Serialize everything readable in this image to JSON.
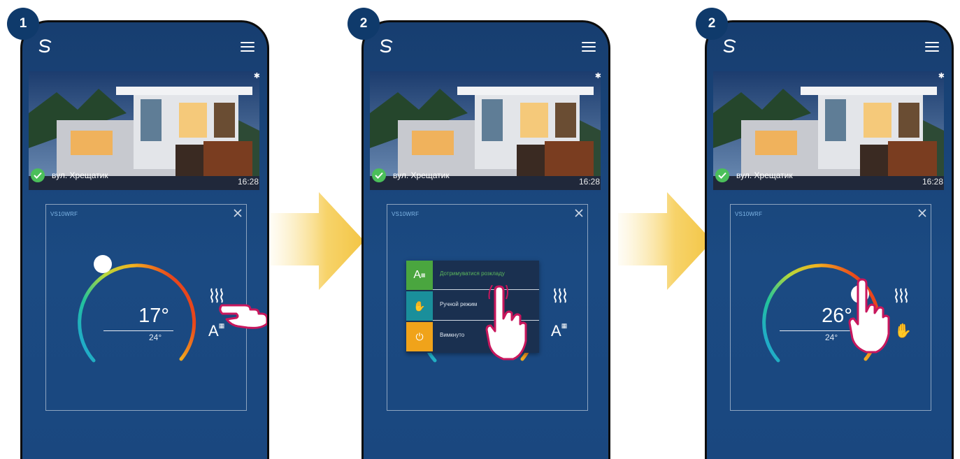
{
  "steps": [
    {
      "badge": "1",
      "location": "вул. Хрещатик",
      "time": "16:28",
      "device": "VS10WRF",
      "current_temp": "17°",
      "set_temp": "24°",
      "mode": "schedule"
    },
    {
      "badge": "2",
      "location": "вул. Хрещатик",
      "time": "16:28",
      "device": "VS10WRF",
      "mode_menu": [
        {
          "label": "Дотримуватися розкладу",
          "icon": "auto-schedule-icon",
          "color": "#4aa63f"
        },
        {
          "label": "Ручной режим",
          "icon": "hand-icon",
          "color": "#1a8f9b"
        },
        {
          "label": "Вимкнуто",
          "icon": "power-icon",
          "color": "#f0a31a"
        }
      ]
    },
    {
      "badge": "2",
      "location": "вул. Хрещатик",
      "time": "16:28",
      "device": "VS10WRF",
      "current_temp": "26°",
      "set_temp": "24°",
      "mode": "manual"
    }
  ],
  "colors": {
    "phone_bg": "#1b4a82",
    "badge": "#0f3a6b",
    "arrow": "#f7d36a",
    "finger_outline": "#c8175d",
    "ok_green": "#4bbf5a"
  }
}
